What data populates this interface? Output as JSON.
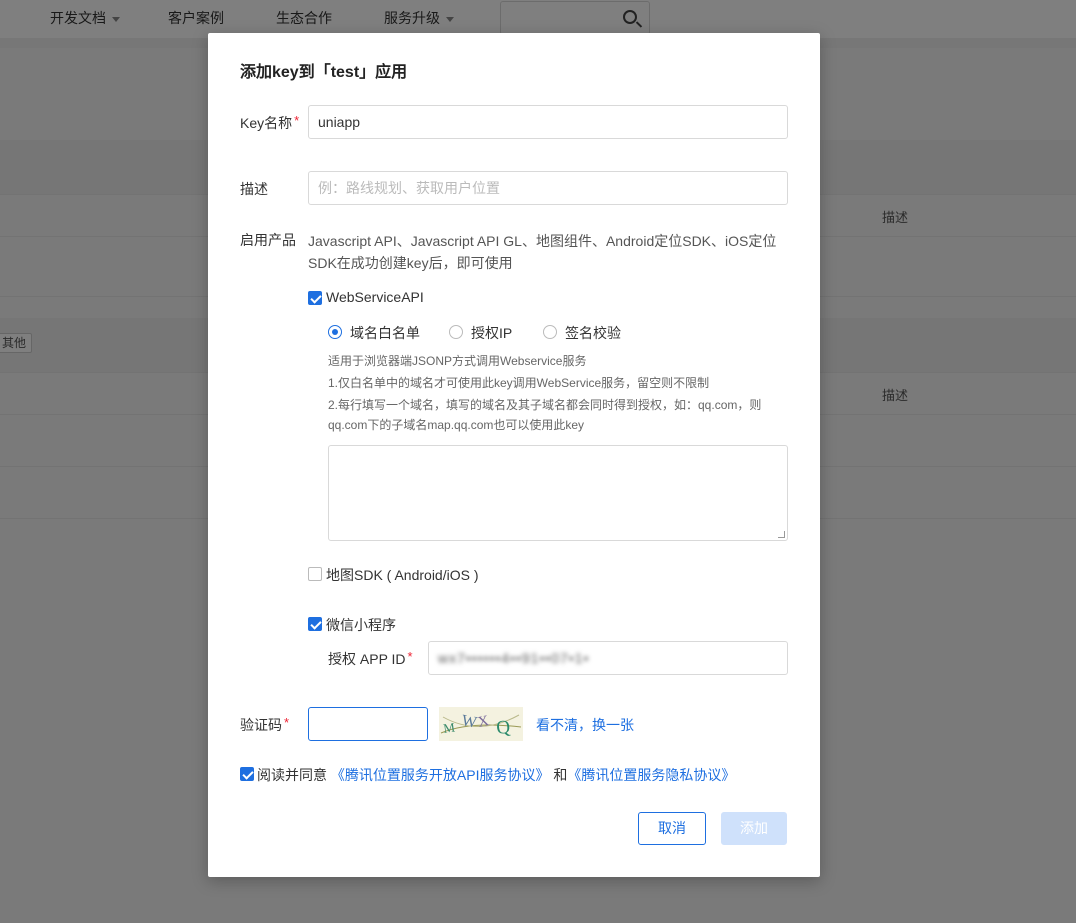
{
  "nav": {
    "items": [
      {
        "label": "开发文档",
        "dropdown": true
      },
      {
        "label": "客户案例",
        "dropdown": false
      },
      {
        "label": "生态合作",
        "dropdown": false
      },
      {
        "label": "服务升级",
        "dropdown": true
      }
    ],
    "search_icon": "search-icon"
  },
  "background": {
    "col_desc_1": "描述",
    "col_desc_2": "描述",
    "tag_other": "其他"
  },
  "modal": {
    "title": "添加key到「test」应用",
    "key_name": {
      "label": "Key名称",
      "required": "*",
      "value": "uniapp"
    },
    "desc": {
      "label": "描述",
      "placeholder": "例：路线规划、获取用户位置"
    },
    "products": {
      "label": "启用产品",
      "text": "Javascript API、Javascript API GL、地图组件、Android定位SDK、iOS定位SDK在成功创建key后，即可使用"
    },
    "webservice": {
      "label": "WebServiceAPI",
      "checked": true,
      "radios": [
        {
          "label": "域名白名单",
          "selected": true
        },
        {
          "label": "授权IP",
          "selected": false
        },
        {
          "label": "签名校验",
          "selected": false
        }
      ],
      "hints": [
        "适用于浏览器端JSONP方式调用Webservice服务",
        "1.仅白名单中的域名才可使用此key调用WebService服务，留空则不限制",
        "2.每行填写一个域名，填写的域名及其子域名都会同时得到授权，如：qq.com，则qq.com下的子域名map.qq.com也可以使用此key"
      ]
    },
    "map_sdk": {
      "label": "地图SDK ( Android/iOS )",
      "checked": false
    },
    "mini_program": {
      "label": "微信小程序",
      "checked": true,
      "appid_label": "授权 APP ID",
      "appid_required": "*",
      "appid_value": "wx7••••••4••91••07•1•"
    },
    "captcha": {
      "label": "验证码",
      "required": "*",
      "image_text": "MWXQ",
      "refresh_link": "看不清，换一张"
    },
    "agreement": {
      "checked": true,
      "prefix": "阅读并同意",
      "link1": "《腾讯位置服务开放API服务协议》",
      "and": "和",
      "link2": "《腾讯位置服务隐私协议》"
    },
    "buttons": {
      "cancel": "取消",
      "add": "添加"
    },
    "colors": {
      "accent": "#1e6fe0",
      "disabled": "#cfe1fb",
      "required": "#e23333"
    }
  }
}
